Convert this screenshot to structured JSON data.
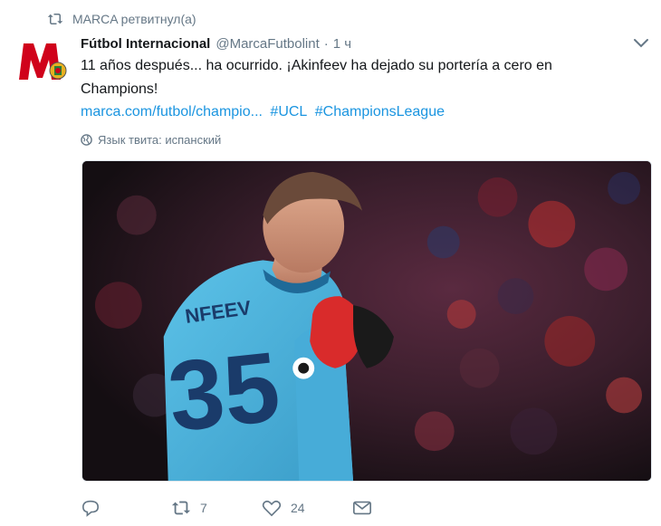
{
  "retweet_context": {
    "text": "MARCA ретвитнул(а)"
  },
  "tweet": {
    "author_name": "Fútbol Internacional",
    "author_handle": "@MarcaFutbolint",
    "separator": "·",
    "time": "1 ч",
    "text": "11 años después... ha ocurrido. ¡Akinfeev ha dejado su portería a cero en Champions!",
    "link": "marca.com/futbol/champio...",
    "hashtags": [
      "#UCL",
      "#ChampionsLeague"
    ],
    "language_note": "Язык твита: испанский",
    "jersey_number": "35",
    "jersey_name": "NFEEV"
  },
  "actions": {
    "reply_count": "",
    "retweet_count": "7",
    "like_count": "24"
  },
  "colors": {
    "link": "#1b95e0",
    "muted": "#657786",
    "text": "#14171a",
    "jersey": "#4fb3dc",
    "glove": "#d92b2b"
  },
  "icons": {
    "retweet": "retweet-icon",
    "caret": "chevron-down-icon",
    "globe": "globe-icon",
    "reply": "reply-icon",
    "like": "heart-icon",
    "dm": "envelope-icon"
  }
}
